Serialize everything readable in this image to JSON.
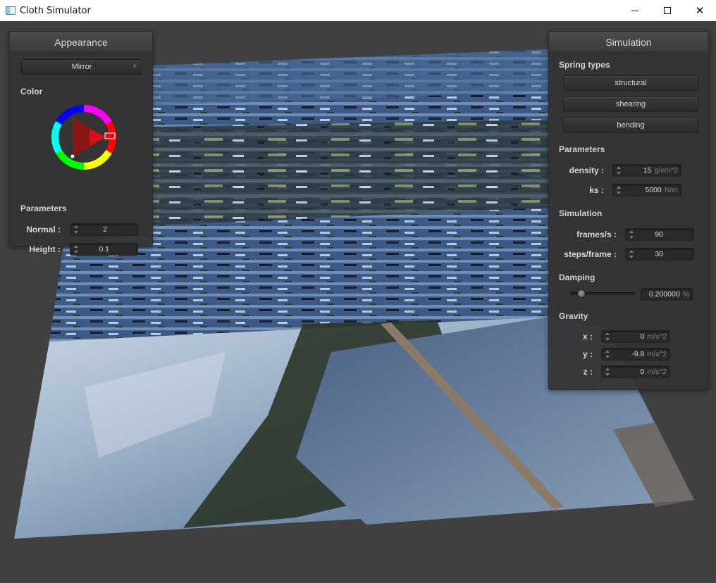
{
  "window": {
    "title": "Cloth Simulator",
    "icon": "app-icon"
  },
  "appearance": {
    "title": "Appearance",
    "shader_button": "Mirror",
    "color_label": "Color",
    "parameters_label": "Parameters",
    "normal": {
      "label": "Normal :",
      "value": "2"
    },
    "height": {
      "label": "Height :",
      "value": "0.1"
    },
    "selected_color": "#e0101a"
  },
  "simulation": {
    "title": "Simulation",
    "spring_types_label": "Spring types",
    "spring_buttons": [
      "structural",
      "shearing",
      "bending"
    ],
    "parameters_label": "Parameters",
    "density": {
      "label": "density :",
      "value": "15",
      "unit": "g/cm^2"
    },
    "ks": {
      "label": "ks :",
      "value": "5000",
      "unit": "N/m"
    },
    "simulation_label": "Simulation",
    "fps": {
      "label": "frames/s :",
      "value": "90"
    },
    "steps": {
      "label": "steps/frame :",
      "value": "30"
    },
    "damping_label": "Damping",
    "damping": {
      "value": "0.200000",
      "unit": "%",
      "slider_fraction": 0.02
    },
    "gravity_label": "Gravity",
    "gravity": [
      {
        "label": "x :",
        "value": "0",
        "unit": "m/s^2"
      },
      {
        "label": "y :",
        "value": "-9.8",
        "unit": "m/s^2"
      },
      {
        "label": "z :",
        "value": "0",
        "unit": "m/s^2"
      }
    ]
  }
}
